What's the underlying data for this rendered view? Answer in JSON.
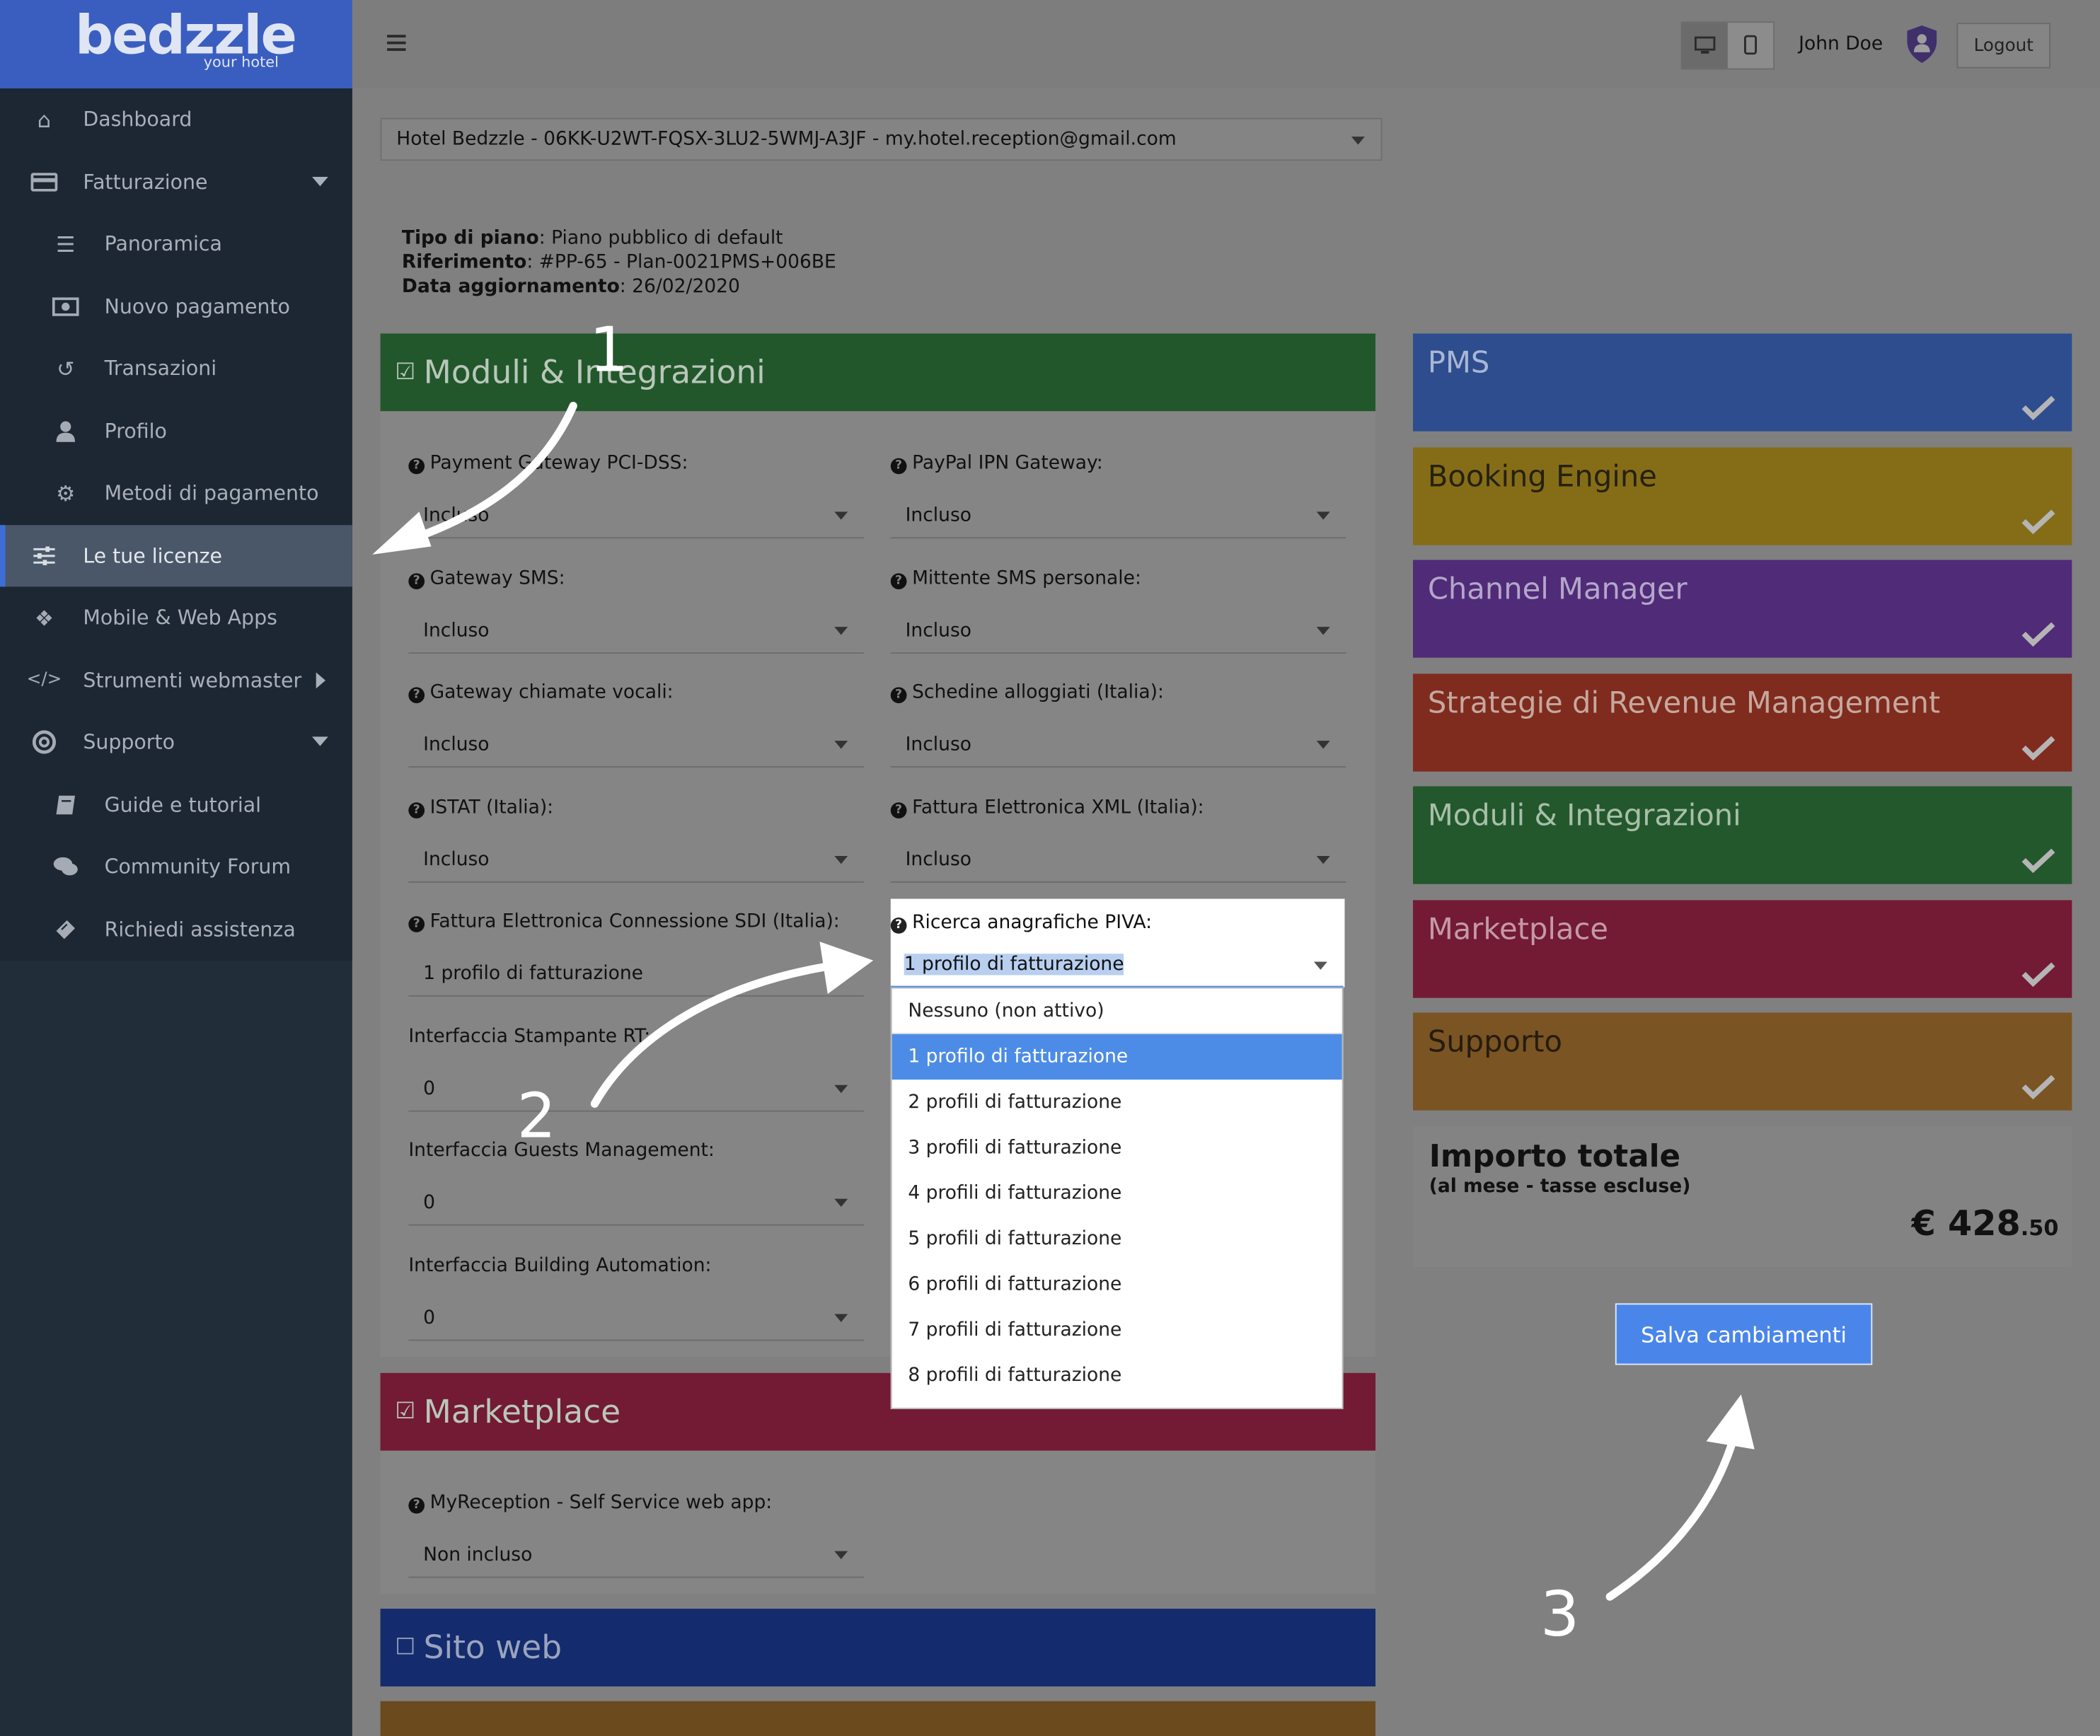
{
  "brand": {
    "logo": "bedzzle",
    "tagline": "your hotel",
    "color": "#3a5ec0"
  },
  "sidebar": {
    "items": [
      {
        "label": "Dashboard",
        "icon": "home-icon"
      },
      {
        "label": "Fatturazione",
        "icon": "credit-card-icon"
      },
      {
        "label": "Panoramica",
        "icon": "list-icon"
      },
      {
        "label": "Nuovo pagamento",
        "icon": "money-icon"
      },
      {
        "label": "Transazioni",
        "icon": "history-icon"
      },
      {
        "label": "Profilo",
        "icon": "user-icon"
      },
      {
        "label": "Metodi di pagamento",
        "icon": "gear-icon"
      },
      {
        "label": "Le tue licenze",
        "icon": "sliders-icon"
      },
      {
        "label": "Mobile & Web Apps",
        "icon": "cubes-icon"
      },
      {
        "label": "Strumenti webmaster",
        "icon": "code-icon"
      },
      {
        "label": "Supporto",
        "icon": "lifebuoy-icon"
      },
      {
        "label": "Guide e tutorial",
        "icon": "book-icon"
      },
      {
        "label": "Community Forum",
        "icon": "comments-icon"
      },
      {
        "label": "Richiedi assistenza",
        "icon": "ticket-icon"
      }
    ]
  },
  "topbar": {
    "user": "John Doe",
    "logout": "Logout"
  },
  "hotel_select": {
    "value": "Hotel Bedzzle - 06KK-U2WT-FQSX-3LU2-5WMJ-A3JF - my.hotel.reception@gmail.com"
  },
  "plan": {
    "tipo_label": "Tipo di piano",
    "tipo_value": ": Piano pubblico di default",
    "rif_label": "Riferimento",
    "rif_value": ": #PP-65 - Plan-0021PMS+006BE",
    "data_label": "Data aggiornamento",
    "data_value": ": 26/02/2020"
  },
  "sections": {
    "moduli": {
      "title": "Moduli & Integrazioni",
      "color": "#22572c"
    },
    "marketplace": {
      "title": "Marketplace",
      "color": "#731a34"
    },
    "sito": {
      "title": "Sito web",
      "color": "#142c6e"
    }
  },
  "fields": {
    "pci": {
      "label": "Payment Gateway PCI-DSS:",
      "value": "Incluso"
    },
    "paypal": {
      "label": "PayPal IPN Gateway:",
      "value": "Incluso"
    },
    "sms": {
      "label": "Gateway SMS:",
      "value": "Incluso"
    },
    "mittente": {
      "label": "Mittente SMS personale:",
      "value": "Incluso"
    },
    "voce": {
      "label": "Gateway chiamate vocali:",
      "value": "Incluso"
    },
    "schedine": {
      "label": "Schedine alloggiati (Italia):",
      "value": "Incluso"
    },
    "istat": {
      "label": "ISTAT (Italia):",
      "value": "Incluso"
    },
    "xml": {
      "label": "Fattura Elettronica XML (Italia):",
      "value": "Incluso"
    },
    "sdi": {
      "label": "Fattura Elettronica Connessione SDI (Italia):",
      "value": "1 profilo di fatturazione"
    },
    "piva": {
      "label": "Ricerca anagrafiche PIVA:",
      "value": "1 profilo di fatturazione"
    },
    "stampante": {
      "label": "Interfaccia Stampante RT:",
      "value": "0"
    },
    "guests": {
      "label": "Interfaccia Guests Management:",
      "value": "0"
    },
    "building": {
      "label": "Interfaccia Building Automation:",
      "value": "0"
    },
    "myreception": {
      "label": "MyReception - Self Service web app:",
      "value": "Non incluso"
    }
  },
  "dropdown": {
    "options": [
      "Nessuno (non attivo)",
      "1 profilo di fatturazione",
      "2 profili di fatturazione",
      "3 profili di fatturazione",
      "4 profili di fatturazione",
      "5 profili di fatturazione",
      "6 profili di fatturazione",
      "7 profili di fatturazione",
      "8 profili di fatturazione"
    ],
    "selected_index": 1,
    "highlight_color": "#4d8ce6"
  },
  "summary": {
    "cards": [
      {
        "title": "PMS",
        "color": "#2d4d8f",
        "text": "#a9b7d4"
      },
      {
        "title": "Booking Engine",
        "color": "#856d18",
        "text": "#262110"
      },
      {
        "title": "Channel Manager",
        "color": "#4f2b78",
        "text": "#b4a6c8"
      },
      {
        "title": "Strategie di Revenue Management",
        "color": "#7f2b1e",
        "text": "#c5a89e"
      },
      {
        "title": "Moduli & Integrazioni",
        "color": "#23582d",
        "text": "#a8bfa8"
      },
      {
        "title": "Marketplace",
        "color": "#731a34",
        "text": "#c39aa7"
      },
      {
        "title": "Supporto",
        "color": "#7a5423",
        "text": "#261c0d"
      }
    ],
    "total_title": "Importo totale",
    "total_sub": "(al mese - tasse escluse)",
    "total_int": "€ 428",
    "total_dec": ".50",
    "save": "Salva cambiamenti",
    "save_color": "#4a86ea"
  },
  "annotations": {
    "a1": "1",
    "a2": "2",
    "a3": "3"
  }
}
